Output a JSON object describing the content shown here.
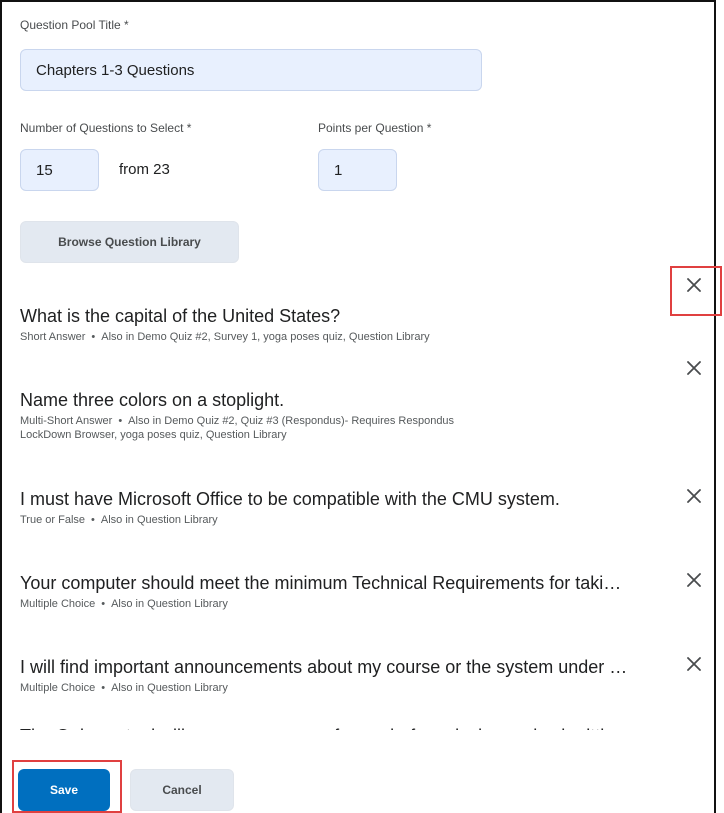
{
  "form": {
    "pool_title_label": "Question Pool Title *",
    "pool_title_value": "Chapters 1-3 Questions",
    "num_questions_label": "Number of Questions to Select *",
    "num_questions_value": "15",
    "from_text": "from 23",
    "points_label": "Points per Question *",
    "points_value": "1",
    "browse_label": "Browse Question Library"
  },
  "questions": [
    {
      "title": "What is the capital of the United States?",
      "type": "Short Answer",
      "also_in": "Also in Demo Quiz #2, Survey 1, yoga poses quiz, Question Library"
    },
    {
      "title": "Name three colors on a stoplight.",
      "type": "Multi-Short Answer",
      "also_in_line1": "Also in Demo Quiz #2, Quiz #3 (Respondus)- Requires Respondus",
      "also_in_line2": "LockDown Browser, yoga poses quiz, Question Library"
    },
    {
      "title": "I must have Microsoft Office to be compatible with the CMU system.",
      "type": "True or False",
      "also_in": "Also in Question Library"
    },
    {
      "title": "Your computer should meet the minimum Technical Requirements for taki…",
      "type": "Multiple Choice",
      "also_in": "Also in Question Library"
    },
    {
      "title": "I will find important announcements about my course or the system under …",
      "type": "Multiple Choice",
      "also_in": "Also in Question Library"
    },
    {
      "title": "The Quizzes tool will save my answers for me before closing and submittin…"
    }
  ],
  "footer": {
    "save_label": "Save",
    "cancel_label": "Cancel"
  },
  "icons": {
    "remove": "close-icon"
  },
  "colors": {
    "highlight": "#e04040",
    "primary": "#006fbf"
  }
}
